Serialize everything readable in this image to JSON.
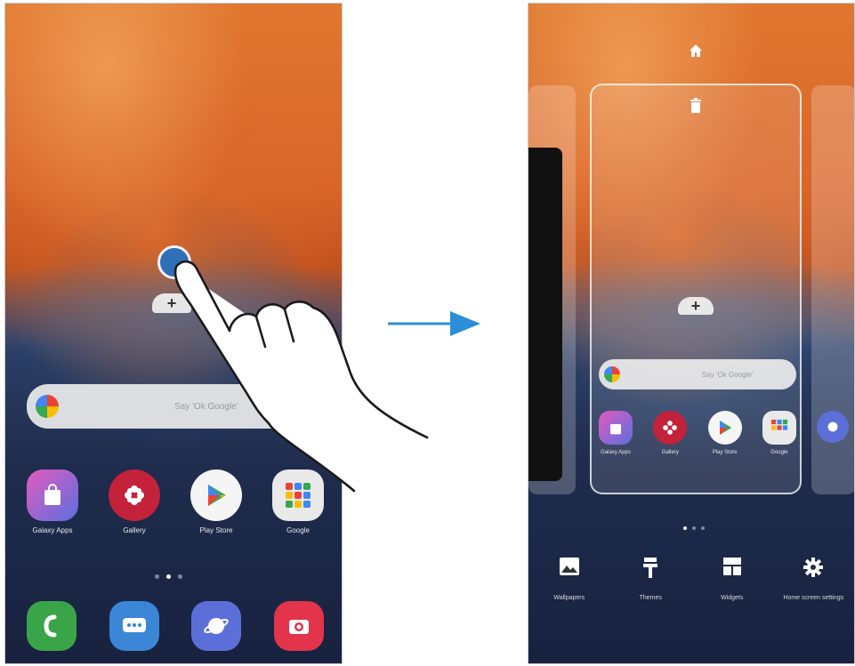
{
  "left_screen": {
    "search_placeholder": "Say 'Ok Google'",
    "apps": [
      {
        "icon": "shopping-bag-icon",
        "label": "Galaxy Apps",
        "color": "#7b4fd6"
      },
      {
        "icon": "gallery-flower-icon",
        "label": "Gallery",
        "color": "#c4213a"
      },
      {
        "icon": "play-store-icon",
        "label": "Play Store",
        "color": "#f5f5f5"
      },
      {
        "icon": "google-folder-icon",
        "label": "Google",
        "color": "#e9e9e9"
      }
    ],
    "dock": [
      {
        "icon": "phone-icon",
        "color": "#3aa548"
      },
      {
        "icon": "messages-icon",
        "color": "#3b86d6"
      },
      {
        "icon": "internet-icon",
        "color": "#5c6fd9"
      },
      {
        "icon": "camera-icon",
        "color": "#e2344a"
      }
    ]
  },
  "right_screen": {
    "search_placeholder": "Say 'Ok Google'",
    "apps": [
      {
        "icon": "shopping-bag-icon",
        "label": "Galaxy Apps",
        "color": "#7b4fd6"
      },
      {
        "icon": "gallery-flower-icon",
        "label": "Gallery",
        "color": "#c4213a"
      },
      {
        "icon": "play-store-icon",
        "label": "Play Store",
        "color": "#f5f5f5"
      },
      {
        "icon": "google-folder-icon",
        "label": "Google",
        "color": "#e9e9e9"
      }
    ],
    "bottom_menu": [
      {
        "icon": "wallpaper-icon",
        "label": "Wallpapers"
      },
      {
        "icon": "themes-brush-icon",
        "label": "Themes"
      },
      {
        "icon": "widgets-icon",
        "label": "Widgets"
      },
      {
        "icon": "gear-icon",
        "label": "Home screen settings"
      }
    ]
  },
  "colors": {
    "arrow": "#2a8fd6"
  }
}
